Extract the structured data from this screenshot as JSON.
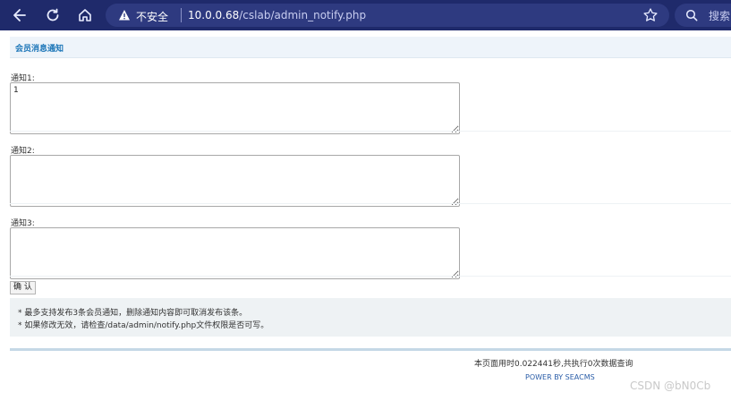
{
  "browser": {
    "security_label": "不安全",
    "url_host": "10.0.0.68",
    "url_path": "/cslab/admin_notify.php",
    "search_placeholder": "搜索"
  },
  "page": {
    "title": "会员消息通知",
    "fields": [
      {
        "label": "通知1:",
        "value": "1"
      },
      {
        "label": "通知2:",
        "value": ""
      },
      {
        "label": "通知3:",
        "value": ""
      }
    ],
    "confirm_label": "确 认",
    "notes": [
      "* 最多支持发布3条会员通知，删除通知内容即可取消发布该条。",
      "* 如果修改无效，请检查/data/admin/notify.php文件权限是否可写。"
    ]
  },
  "footer": {
    "stats": "本页面用时0.022441秒,共执行0次数据查询",
    "power": "POWER BY SEACMS"
  },
  "watermark": "CSDN @bN0Cb"
}
